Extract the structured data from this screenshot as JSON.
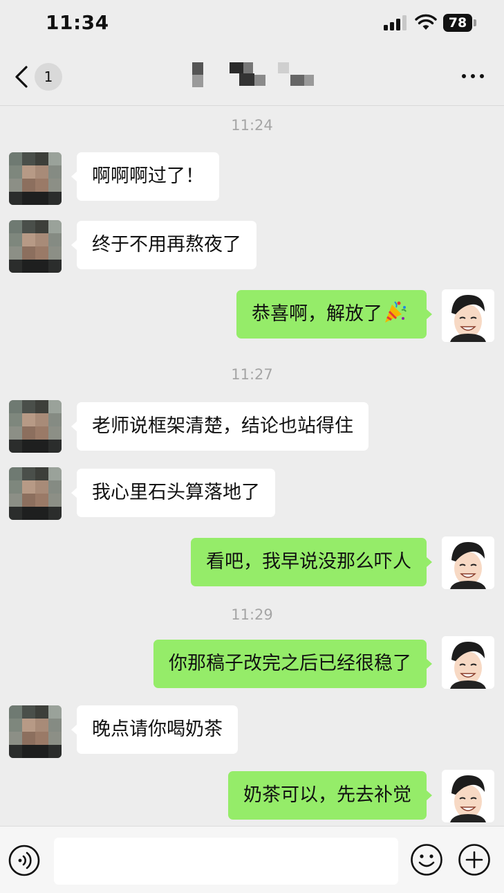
{
  "status_bar": {
    "time": "11:34",
    "battery": "78"
  },
  "nav": {
    "unread_count": "1"
  },
  "chat": {
    "messages": [
      {
        "type": "time",
        "text": "11:24"
      },
      {
        "type": "msg",
        "side": "left",
        "text": "啊啊啊过了！"
      },
      {
        "type": "msg",
        "side": "left",
        "text": "终于不用再熬夜了"
      },
      {
        "type": "msg",
        "side": "right",
        "text": "恭喜啊，解放了",
        "emoji": "party-popper"
      },
      {
        "type": "time",
        "text": "11:27"
      },
      {
        "type": "msg",
        "side": "left",
        "text": "老师说框架清楚，结论也站得住"
      },
      {
        "type": "msg",
        "side": "left",
        "text": "我心里石头算落地了"
      },
      {
        "type": "msg",
        "side": "right",
        "text": "看吧，我早说没那么吓人"
      },
      {
        "type": "time",
        "text": "11:29"
      },
      {
        "type": "msg",
        "side": "right",
        "text": "你那稿子改完之后已经很稳了"
      },
      {
        "type": "msg",
        "side": "left",
        "text": "晚点请你喝奶茶"
      },
      {
        "type": "msg",
        "side": "right",
        "text": "奶茶可以，先去补觉"
      }
    ]
  },
  "input_bar": {
    "value": "",
    "placeholder": ""
  },
  "colors": {
    "background": "#ededed",
    "sent_bubble": "#95ec69",
    "received_bubble": "#ffffff",
    "timestamp": "#a5a5a5"
  },
  "icons": [
    "back-chevron-icon",
    "more-icon",
    "voice-icon",
    "emoji-icon",
    "plus-icon",
    "party-popper-emoji"
  ]
}
